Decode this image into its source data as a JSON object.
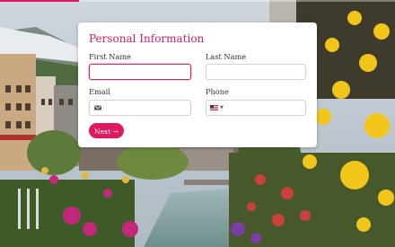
{
  "progress": {
    "fraction": 0.2
  },
  "form": {
    "title": "Personal Information",
    "first_name": {
      "label": "First Name",
      "value": ""
    },
    "last_name": {
      "label": "Last Name",
      "value": ""
    },
    "email": {
      "label": "Email",
      "value": "",
      "icon": "envelope-icon"
    },
    "phone": {
      "label": "Phone",
      "value": "",
      "country_icon": "us-flag-icon"
    },
    "next_label": "Next →"
  },
  "colors": {
    "accent": "#e0195f",
    "title": "#d81b60"
  }
}
